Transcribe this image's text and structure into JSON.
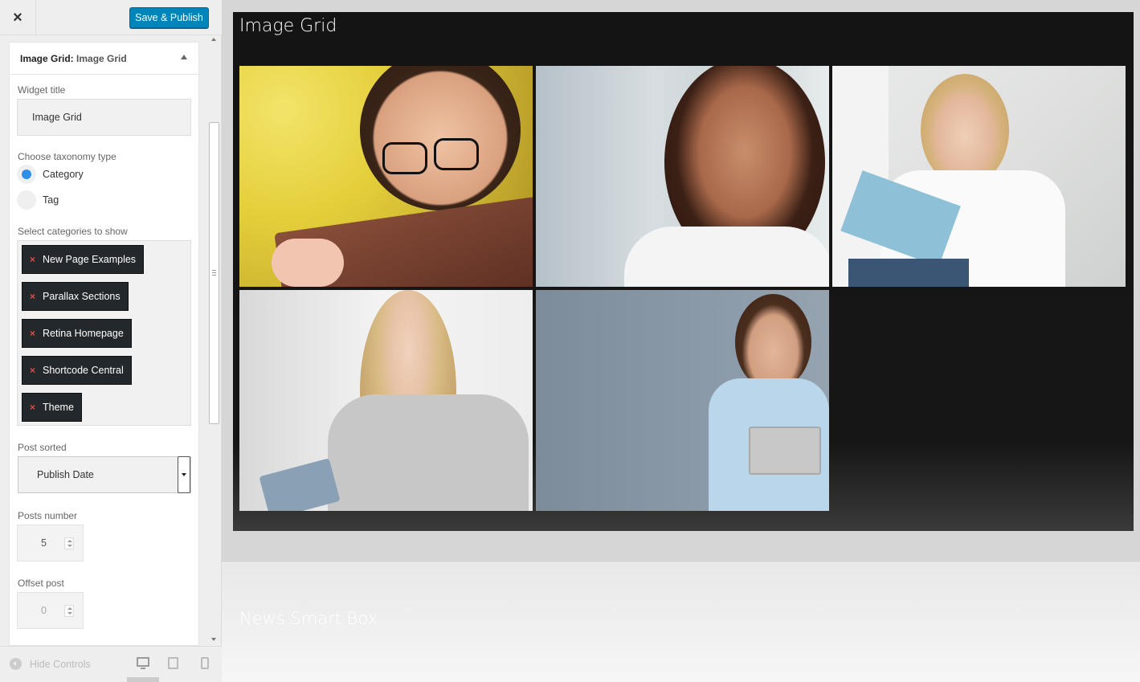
{
  "toolbar": {
    "close_icon": "×",
    "save_label": "Save & Publish",
    "save_color": "#0085ba"
  },
  "widget": {
    "header_prefix": "Image Grid:",
    "header_name": "Image Grid",
    "title_label": "Widget title",
    "title_value": "Image Grid",
    "taxonomy_label": "Choose taxonomy type",
    "taxonomy_options": [
      {
        "label": "Category",
        "selected": true
      },
      {
        "label": "Tag",
        "selected": false
      }
    ],
    "categories_label": "Select categories to show",
    "categories": [
      "New Page Examples",
      "Parallax Sections",
      "Retina Homepage",
      "Shortcode Central",
      "Theme"
    ],
    "sort_label": "Post sorted",
    "sort_value": "Publish Date",
    "posts_number_label": "Posts number",
    "posts_number_value": "5",
    "offset_label": "Offset post",
    "offset_value": "0"
  },
  "footer": {
    "hide_controls_label": "Hide Controls",
    "devices": [
      "desktop-icon",
      "tablet-icon",
      "mobile-icon"
    ]
  },
  "preview": {
    "grid_title": "Image Grid",
    "images": [
      "woman-with-glasses-photo",
      "smiling-woman-brown-hair-photo",
      "woman-reading-book-photo",
      "blonde-woman-with-tablet-photo",
      "man-holding-laptop-photo"
    ],
    "next_section_title": "News Smart Box"
  }
}
